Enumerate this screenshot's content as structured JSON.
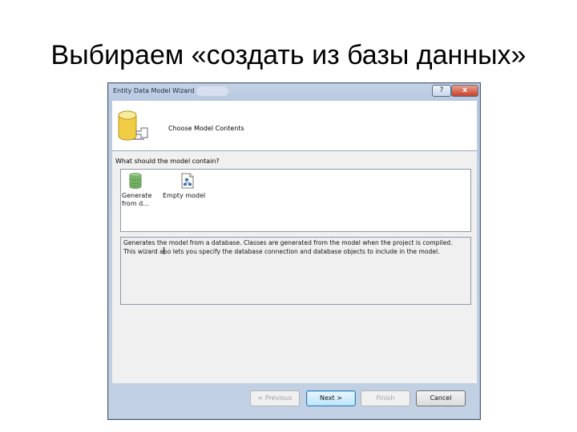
{
  "slide": {
    "title": "Выбираем «создать из базы данных»"
  },
  "window": {
    "title": "Entity Data Model Wizard",
    "help_label": "?",
    "close_label": "x"
  },
  "header": {
    "heading": "Choose Model Contents"
  },
  "content": {
    "question": "What should the model contain?",
    "options": [
      {
        "label_line1": "Generate",
        "label_line2": "from d...",
        "icon": "database-icon"
      },
      {
        "label_line1": "Empty model",
        "icon": "empty-model-icon"
      }
    ],
    "description_line1": "Generates the model from a database. Classes are generated from the model when the project is compiled.",
    "description_line2_pre": "This wizard a",
    "description_line2_post": "so lets you specify the database connection and database objects to include in the model."
  },
  "buttons": {
    "previous": "< Previous",
    "next": "Next >",
    "finish": "Finish",
    "cancel": "Cancel"
  }
}
